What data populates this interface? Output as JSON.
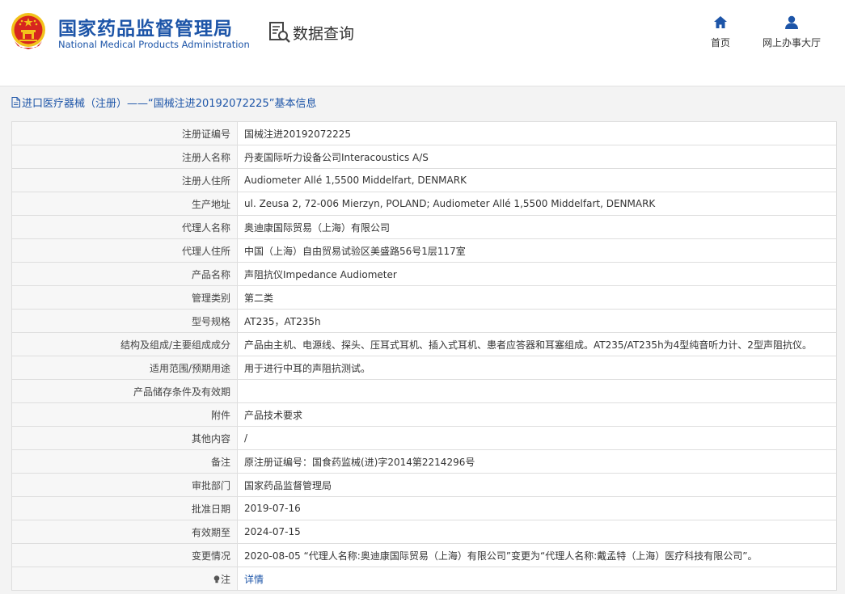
{
  "header": {
    "org_name_cn": "国家药品监督管理局",
    "org_name_en": "National Medical Products Administration",
    "section_title": "数据查询",
    "nav": [
      {
        "label": "首页",
        "icon": "home-icon"
      },
      {
        "label": "网上办事大厅",
        "icon": "user-icon"
      }
    ]
  },
  "detail": {
    "title": "进口医疗器械（注册）——“国械注进20192072225”基本信息",
    "fields": [
      {
        "label": "注册证编号",
        "value": "国械注进20192072225"
      },
      {
        "label": "注册人名称",
        "value": "丹麦国际听力设备公司Interacoustics A/S"
      },
      {
        "label": "注册人住所",
        "value": "Audiometer Allé 1,5500 Middelfart, DENMARK"
      },
      {
        "label": "生产地址",
        "value": "ul. Zeusa 2, 72-006 Mierzyn, POLAND; Audiometer Allé 1,5500 Middelfart, DENMARK"
      },
      {
        "label": "代理人名称",
        "value": "奥迪康国际贸易（上海）有限公司"
      },
      {
        "label": "代理人住所",
        "value": "中国（上海）自由贸易试验区美盛路56号1层117室"
      },
      {
        "label": "产品名称",
        "value": "声阻抗仪Impedance Audiometer"
      },
      {
        "label": "管理类别",
        "value": "第二类"
      },
      {
        "label": "型号规格",
        "value": "AT235，AT235h"
      },
      {
        "label": "结构及组成/主要组成成分",
        "value": "产品由主机、电源线、探头、压耳式耳机、插入式耳机、患者应答器和耳塞组成。AT235/AT235h为4型纯音听力计、2型声阻抗仪。"
      },
      {
        "label": "适用范围/预期用途",
        "value": "用于进行中耳的声阻抗测试。"
      },
      {
        "label": "产品储存条件及有效期",
        "value": ""
      },
      {
        "label": "附件",
        "value": "产品技术要求"
      },
      {
        "label": "其他内容",
        "value": "/"
      },
      {
        "label": "备注",
        "value": "原注册证编号：国食药监械(进)字2014第2214296号"
      },
      {
        "label": "审批部门",
        "value": "国家药品监督管理局"
      },
      {
        "label": "批准日期",
        "value": "2019-07-16"
      },
      {
        "label": "有效期至",
        "value": "2024-07-15"
      },
      {
        "label": "变更情况",
        "value": "2020-08-05 “代理人名称:奥迪康国际贸易（上海）有限公司”变更为“代理人名称:戴孟特（上海）医疗科技有限公司”。"
      }
    ],
    "note": {
      "label": "注",
      "link": "详情",
      "icon": "lightbulb-icon"
    }
  },
  "colors": {
    "brand_blue": "#1d55a8",
    "emblem_red": "#d7261f",
    "emblem_gold": "#f2c21b"
  }
}
